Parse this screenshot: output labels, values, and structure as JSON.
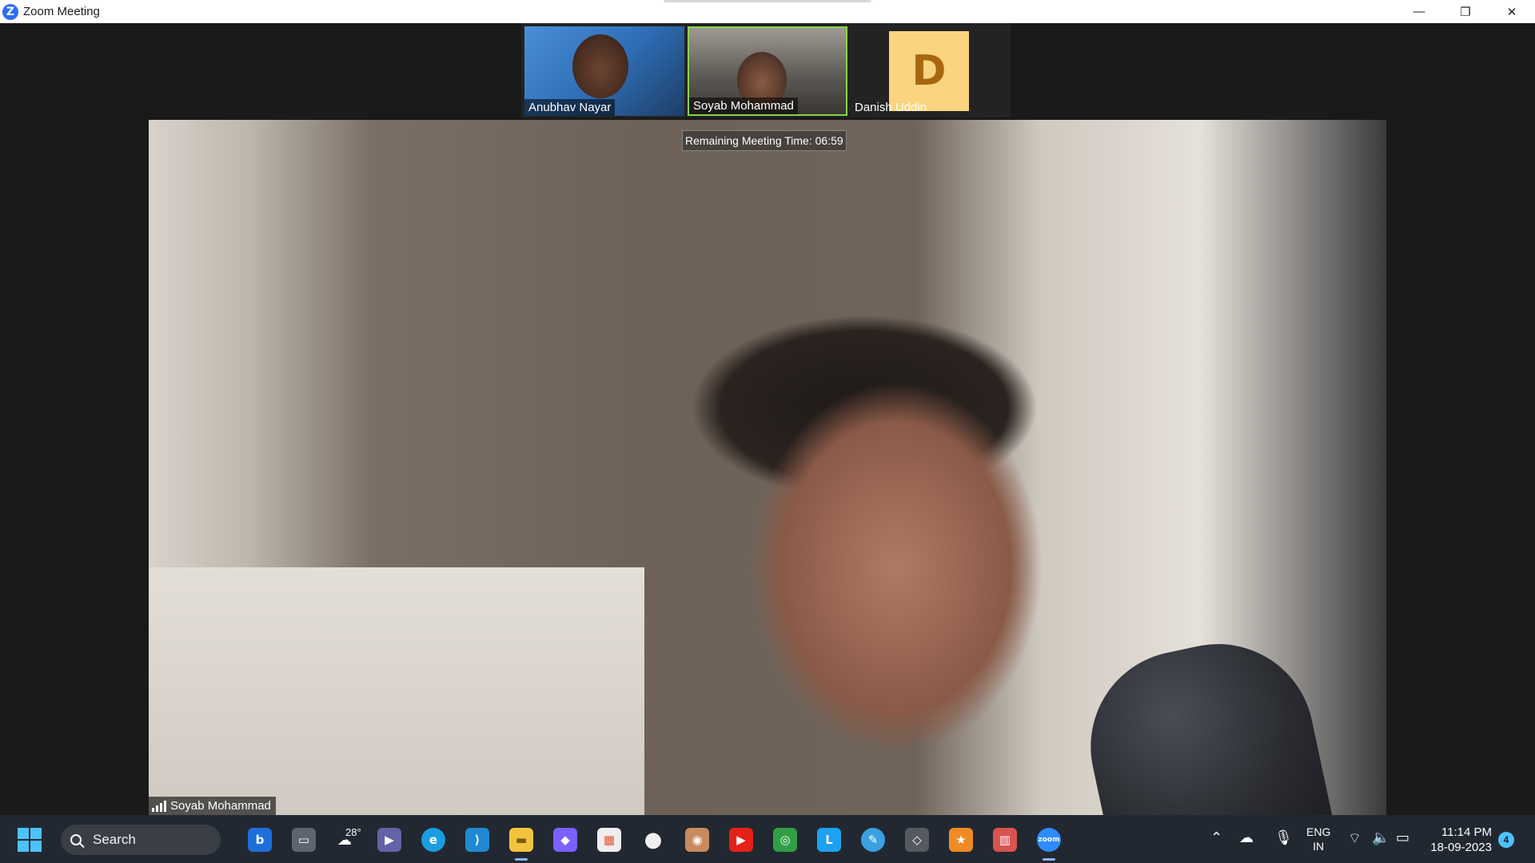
{
  "window": {
    "title": "Zoom Meeting",
    "logo_letter": "Z",
    "minimize_glyph": "—",
    "restore_glyph": "❐",
    "close_glyph": "✕"
  },
  "gallery": [
    {
      "name": "Anubhav Nayar",
      "type": "video"
    },
    {
      "name": "Soyab Mohammad",
      "type": "video",
      "active_speaker": true
    },
    {
      "name": "Danish Uddin",
      "type": "avatar",
      "avatar_letter": "D",
      "avatar_color": "#fbd480"
    }
  ],
  "main_video": {
    "speaker_name": "Soyab Mohammad",
    "remaining_time_label": "Remaining Meeting Time: 06:59"
  },
  "taskbar": {
    "search_label": "Search",
    "weather_temp": "28°",
    "pinned_apps": [
      {
        "name": "bing-icon",
        "glyph": "b",
        "color": "#1e6fd9"
      },
      {
        "name": "file-explorer-multitask-icon",
        "glyph": "▭",
        "color": "#5d6570"
      },
      {
        "name": "weather-icon",
        "glyph": "☁",
        "color": "#3a7bd5"
      },
      {
        "name": "meet-video-icon",
        "glyph": "▶",
        "color": "#6264a7"
      },
      {
        "name": "edge-icon",
        "glyph": "e",
        "color": "#1b9de2"
      },
      {
        "name": "vscode-icon",
        "glyph": "⟩",
        "color": "#1f8ad2"
      },
      {
        "name": "folder-icon",
        "glyph": "▬",
        "color": "#f4c33d"
      },
      {
        "name": "copilot-icon",
        "glyph": "◆",
        "color": "#7b61ff"
      },
      {
        "name": "store-icon",
        "glyph": "▦",
        "color": "#eeeeee"
      },
      {
        "name": "github-icon",
        "glyph": "●",
        "color": "#f0f0f0"
      },
      {
        "name": "app-icon",
        "glyph": "◉",
        "color": "#c98a5e"
      },
      {
        "name": "youtube-icon",
        "glyph": "▶",
        "color": "#e62117"
      },
      {
        "name": "glasses-app-icon",
        "glyph": "◎",
        "color": "#2f9e44"
      },
      {
        "name": "l-app-icon",
        "glyph": "L",
        "color": "#1da1f2"
      },
      {
        "name": "paint-icon",
        "glyph": "✎",
        "color": "#3aa0e0"
      },
      {
        "name": "git-icon",
        "glyph": "◇",
        "color": "#555a61"
      },
      {
        "name": "reward-icon",
        "glyph": "★",
        "color": "#f08a24"
      },
      {
        "name": "bars-app-icon",
        "glyph": "▥",
        "color": "#d9534f"
      },
      {
        "name": "zoom-icon",
        "glyph": "zoom",
        "color": "#2d8cff"
      }
    ],
    "language": "ENG",
    "region": "IN",
    "time": "11:14 PM",
    "date": "18-09-2023",
    "notification_count": "4"
  }
}
